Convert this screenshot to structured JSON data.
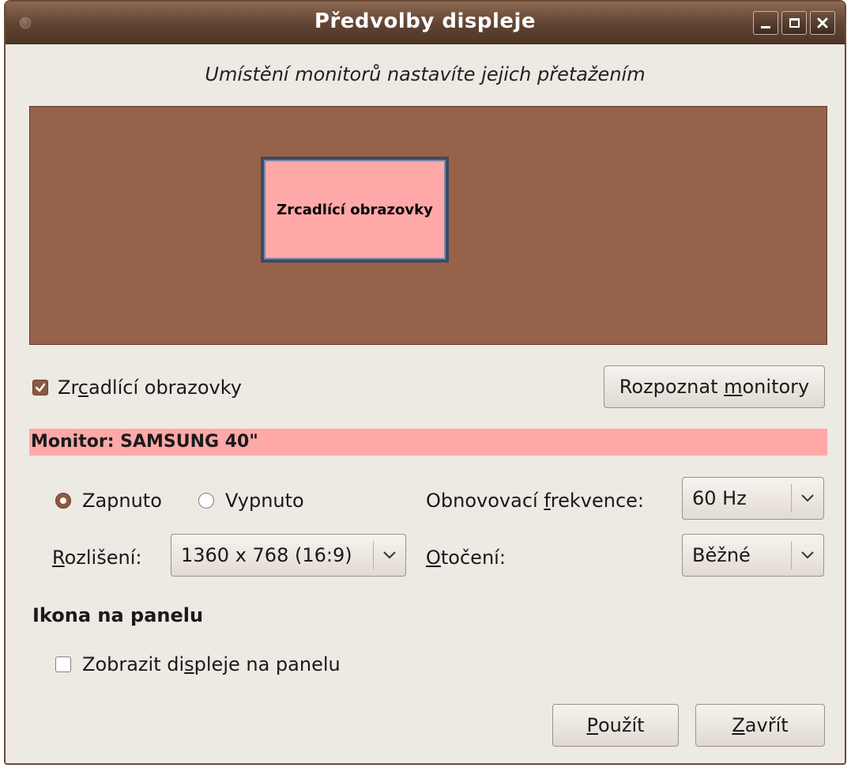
{
  "window": {
    "title": "Předvolby displeje"
  },
  "instruction": "Umístění monitorů nastavíte jejich přetažením",
  "canvas": {
    "monitor_label": "Zrcadlící obrazovky"
  },
  "mirror": {
    "label_pre": "Zr",
    "label_mnemonic": "c",
    "label_post": "adlící obrazovky",
    "checked": true
  },
  "detect_button": {
    "label_pre": "Rozpoznat ",
    "label_mnemonic": "m",
    "label_post": "onitory"
  },
  "monitor_header": "Monitor: SAMSUNG 40\"",
  "power": {
    "on_label": "Zapnuto",
    "off_label": "Vypnuto",
    "selected": "on"
  },
  "refresh": {
    "label_pre": "Obnovovací ",
    "label_mnemonic": "f",
    "label_post": "rekvence:",
    "value": "60 Hz"
  },
  "resolution": {
    "label_mnemonic": "R",
    "label_post": "ozlišení:",
    "value": "1360 x 768 (16:9)"
  },
  "rotation": {
    "label_mnemonic": "O",
    "label_post": "točení:",
    "value": "Běžné"
  },
  "panel": {
    "section_title": "Ikona na panelu",
    "show_label_pre": "Zobrazit di",
    "show_label_mnemonic": "s",
    "show_label_post": "pleje na panelu",
    "checked": false
  },
  "buttons": {
    "apply_mnemonic": "P",
    "apply_post": "oužít",
    "close_mnemonic": "Z",
    "close_post": "avřít"
  },
  "colors": {
    "accent": "#8c5a40",
    "canvas_bg": "#96624a",
    "monitor_fill": "#ffa8a8",
    "window_bg": "#ede9e3"
  }
}
